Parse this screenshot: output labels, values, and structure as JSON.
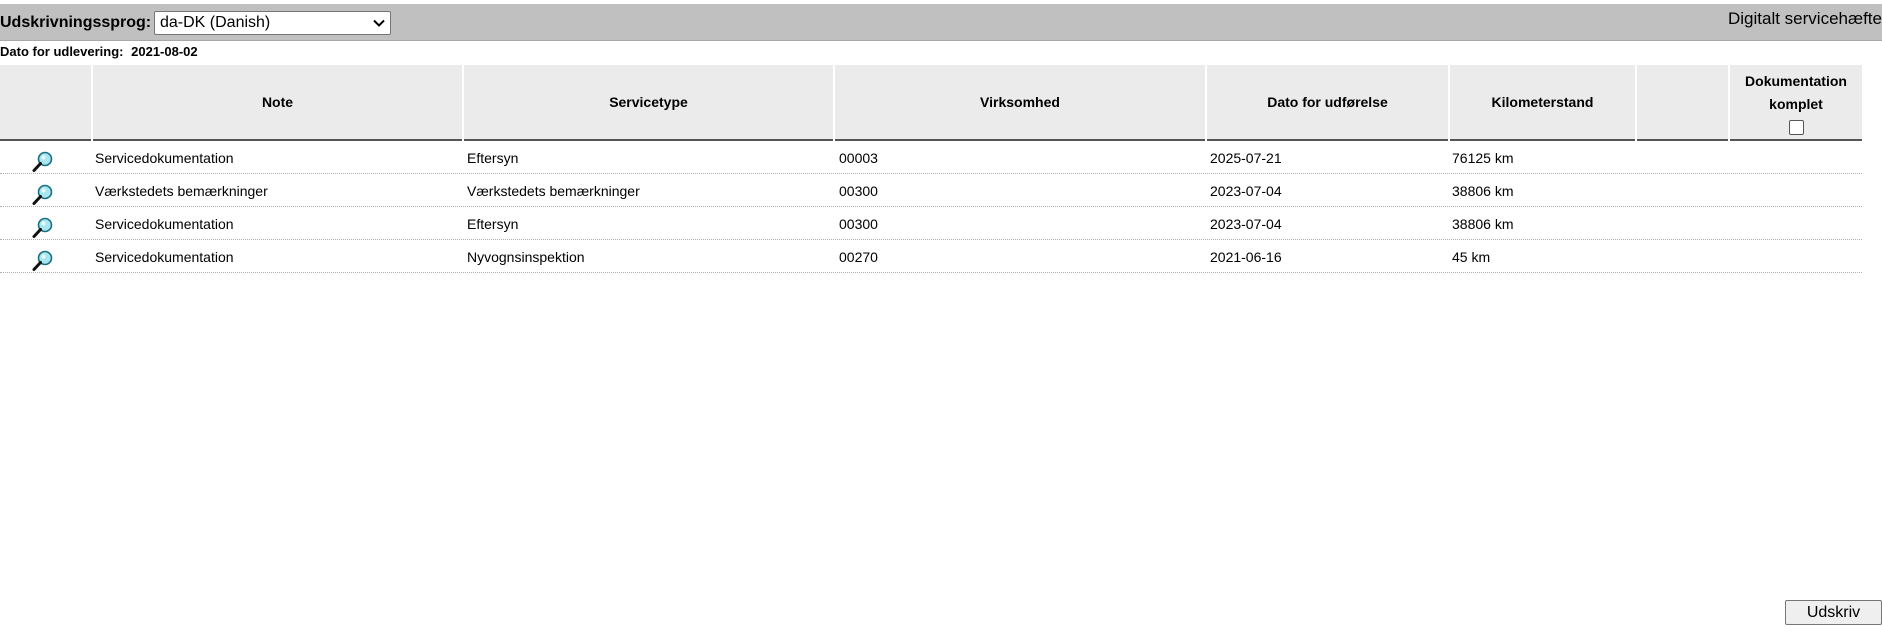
{
  "toolbar": {
    "language_label": "Udskrivningssprog:",
    "language_selected": "da-DK (Danish)",
    "app_title": "Digitalt servicehæfte"
  },
  "delivery": {
    "label": "Dato for udlevering:",
    "value": "2021-08-02"
  },
  "table": {
    "headers": {
      "note": "Note",
      "servicetype": "Servicetype",
      "virksomhed": "Virksomhed",
      "dato": "Dato for udførelse",
      "km": "Kilometerstand",
      "doc_line1": "Dokumentation",
      "doc_line2": "komplet"
    },
    "doc_complete_checked": false,
    "rows": [
      {
        "note": "Servicedokumentation",
        "servicetype": "Eftersyn",
        "virksomhed": "00003",
        "dato": "2025-07-21",
        "km": "76125 km"
      },
      {
        "note": "Værkstedets bemærkninger",
        "servicetype": "Værkstedets bemærkninger",
        "virksomhed": "00300",
        "dato": "2023-07-04",
        "km": "38806 km"
      },
      {
        "note": "Servicedokumentation",
        "servicetype": "Eftersyn",
        "virksomhed": "00300",
        "dato": "2023-07-04",
        "km": "38806 km"
      },
      {
        "note": "Servicedokumentation",
        "servicetype": "Nyvognsinspektion",
        "virksomhed": "00270",
        "dato": "2021-06-16",
        "km": "45 km"
      }
    ]
  },
  "actions": {
    "print_label": "Udskriv"
  },
  "icons": {
    "row_view": "magnifier-icon",
    "select_chevron": "chevron-down-icon"
  }
}
